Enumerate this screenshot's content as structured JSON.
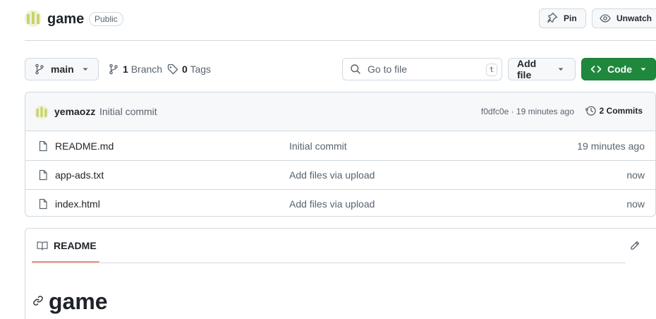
{
  "repo": {
    "name": "game",
    "visibility": "Public",
    "pin_label": "Pin",
    "unwatch_label": "Unwatch"
  },
  "toolbar": {
    "branch": "main",
    "branch_count": "1",
    "branch_word": "Branch",
    "tag_count": "0",
    "tag_word": "Tags",
    "goto_placeholder": "Go to file",
    "goto_shortcut": "t",
    "add_file_label": "Add file",
    "code_label": "Code"
  },
  "latest_commit": {
    "author": "yemaozz",
    "message": "Initial commit",
    "meta": "f0dfc0e · 19 minutes ago",
    "commits_label": "2 Commits"
  },
  "files": [
    {
      "name": "README.md",
      "commit": "Initial commit",
      "date": "19 minutes ago"
    },
    {
      "name": "app-ads.txt",
      "commit": "Add files via upload",
      "date": "now"
    },
    {
      "name": "index.html",
      "commit": "Add files via upload",
      "date": "now"
    }
  ],
  "readme": {
    "tab_label": "README",
    "heading": "game"
  },
  "colors": {
    "accent_green": "#1f883d",
    "tab_underline": "#fd8c73",
    "border": "#d1d9e0"
  },
  "icons": [
    "repo-avatar",
    "pin-icon",
    "eye-icon",
    "branch-icon",
    "tag-icon",
    "search-icon",
    "code-icon",
    "history-icon",
    "file-icon",
    "book-icon",
    "pencil-icon",
    "link-icon"
  ]
}
